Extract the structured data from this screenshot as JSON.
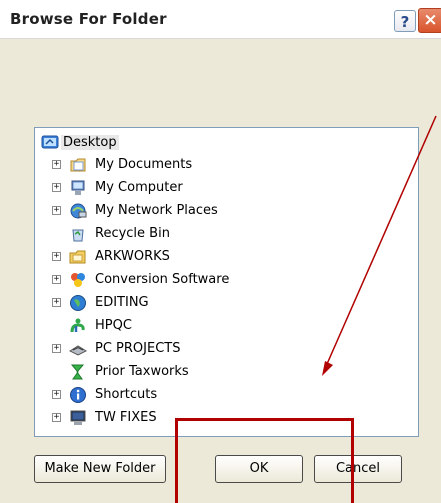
{
  "dialog": {
    "title": "Browse For Folder",
    "help_icon": "?",
    "close_icon": "×"
  },
  "tree": {
    "items": [
      {
        "label": "Desktop",
        "icon": "desktop-icon",
        "expander": ""
      },
      {
        "label": "My Documents",
        "icon": "my-documents-icon",
        "expander": "+"
      },
      {
        "label": "My Computer",
        "icon": "my-computer-icon",
        "expander": "+"
      },
      {
        "label": "My Network Places",
        "icon": "network-places-icon",
        "expander": "+"
      },
      {
        "label": "Recycle Bin",
        "icon": "recycle-bin-icon",
        "expander": ""
      },
      {
        "label": "ARKWORKS",
        "icon": "folder-icon",
        "expander": "+"
      },
      {
        "label": "Conversion Software",
        "icon": "conversion-software-icon",
        "expander": "+"
      },
      {
        "label": "EDITING",
        "icon": "editing-globe-icon",
        "expander": "+"
      },
      {
        "label": "HPQC",
        "icon": "hpqc-icon",
        "expander": ""
      },
      {
        "label": "PC PROJECTS",
        "icon": "pc-projects-icon",
        "expander": "+"
      },
      {
        "label": "Prior Taxworks",
        "icon": "prior-taxworks-icon",
        "expander": ""
      },
      {
        "label": "Shortcuts",
        "icon": "shortcuts-info-icon",
        "expander": "+"
      },
      {
        "label": "TW FIXES",
        "icon": "tw-fixes-monitor-icon",
        "expander": "+"
      }
    ]
  },
  "buttons": {
    "make_new_folder": "Make New Folder",
    "ok": "OK",
    "cancel": "Cancel"
  },
  "colors": {
    "annotation": "#b00000",
    "dialog_bg": "#ece9d8",
    "tree_border": "#7f9db9"
  }
}
